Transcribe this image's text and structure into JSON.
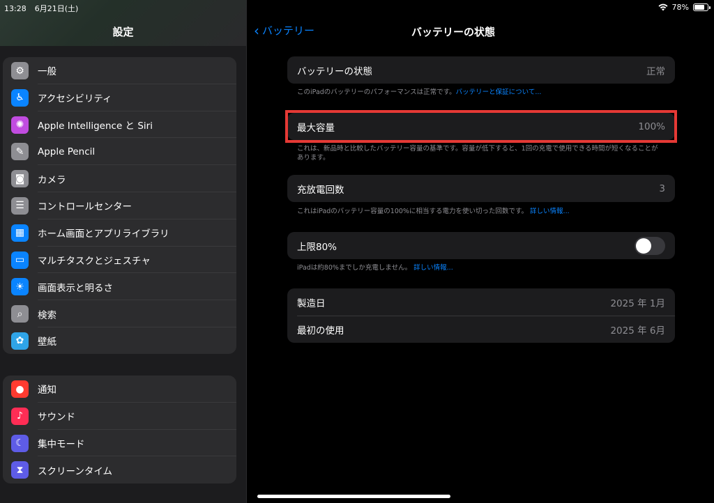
{
  "status": {
    "time": "13:28",
    "date": "6月21日(土)",
    "battery_pct": "78%"
  },
  "sidebar": {
    "title": "設定",
    "group1": [
      {
        "label": "一般",
        "icon": "gear-icon",
        "color": "#8e8e93"
      },
      {
        "label": "アクセシビリティ",
        "icon": "accessibility-icon",
        "color": "#0a84ff"
      },
      {
        "label": "Apple Intelligence と Siri",
        "icon": "siri-icon",
        "color": "#c14ce0"
      },
      {
        "label": "Apple Pencil",
        "icon": "pencil-icon",
        "color": "#8e8e93"
      },
      {
        "label": "カメラ",
        "icon": "camera-icon",
        "color": "#8e8e93"
      },
      {
        "label": "コントロールセンター",
        "icon": "control-center-icon",
        "color": "#8e8e93"
      },
      {
        "label": "ホーム画面とアプリライブラリ",
        "icon": "home-screen-icon",
        "color": "#0a84ff"
      },
      {
        "label": "マルチタスクとジェスチャ",
        "icon": "multitask-icon",
        "color": "#0a84ff"
      },
      {
        "label": "画面表示と明るさ",
        "icon": "brightness-icon",
        "color": "#0a84ff"
      },
      {
        "label": "検索",
        "icon": "search-icon",
        "color": "#8e8e93"
      },
      {
        "label": "壁紙",
        "icon": "wallpaper-icon",
        "color": "#2fa4e7"
      }
    ],
    "group2": [
      {
        "label": "通知",
        "icon": "bell-icon",
        "color": "#ff3b30"
      },
      {
        "label": "サウンド",
        "icon": "speaker-icon",
        "color": "#ff2d55"
      },
      {
        "label": "集中モード",
        "icon": "moon-icon",
        "color": "#5e5ce6"
      },
      {
        "label": "スクリーンタイム",
        "icon": "hourglass-icon",
        "color": "#5e5ce6"
      }
    ]
  },
  "nav": {
    "back_label": "バッテリー",
    "title": "バッテリーの状態"
  },
  "battery_health": {
    "label": "バッテリーの状態",
    "value": "正常",
    "note": "このiPadのバッテリーのパフォーマンスは正常です。",
    "note_link": "バッテリーと保証について..."
  },
  "max_capacity": {
    "label": "最大容量",
    "value": "100%",
    "note": "これは、新品時と比較したバッテリー容量の基準です。容量が低下すると、1回の充電で使用できる時間が短くなることがあります。"
  },
  "cycle_count": {
    "label": "充放電回数",
    "value": "3",
    "note": "これはiPadのバッテリー容量の100%に相当する電力を使い切った回数です。",
    "note_link": "詳しい情報..."
  },
  "limit": {
    "label": "上限80%",
    "enabled": false,
    "note": "iPadは約80%までしか充電しません。",
    "note_link": "詳しい情報..."
  },
  "manufacture": {
    "label": "製造日",
    "value": "2025 年 1月"
  },
  "first_use": {
    "label": "最初の使用",
    "value": "2025 年 6月"
  }
}
